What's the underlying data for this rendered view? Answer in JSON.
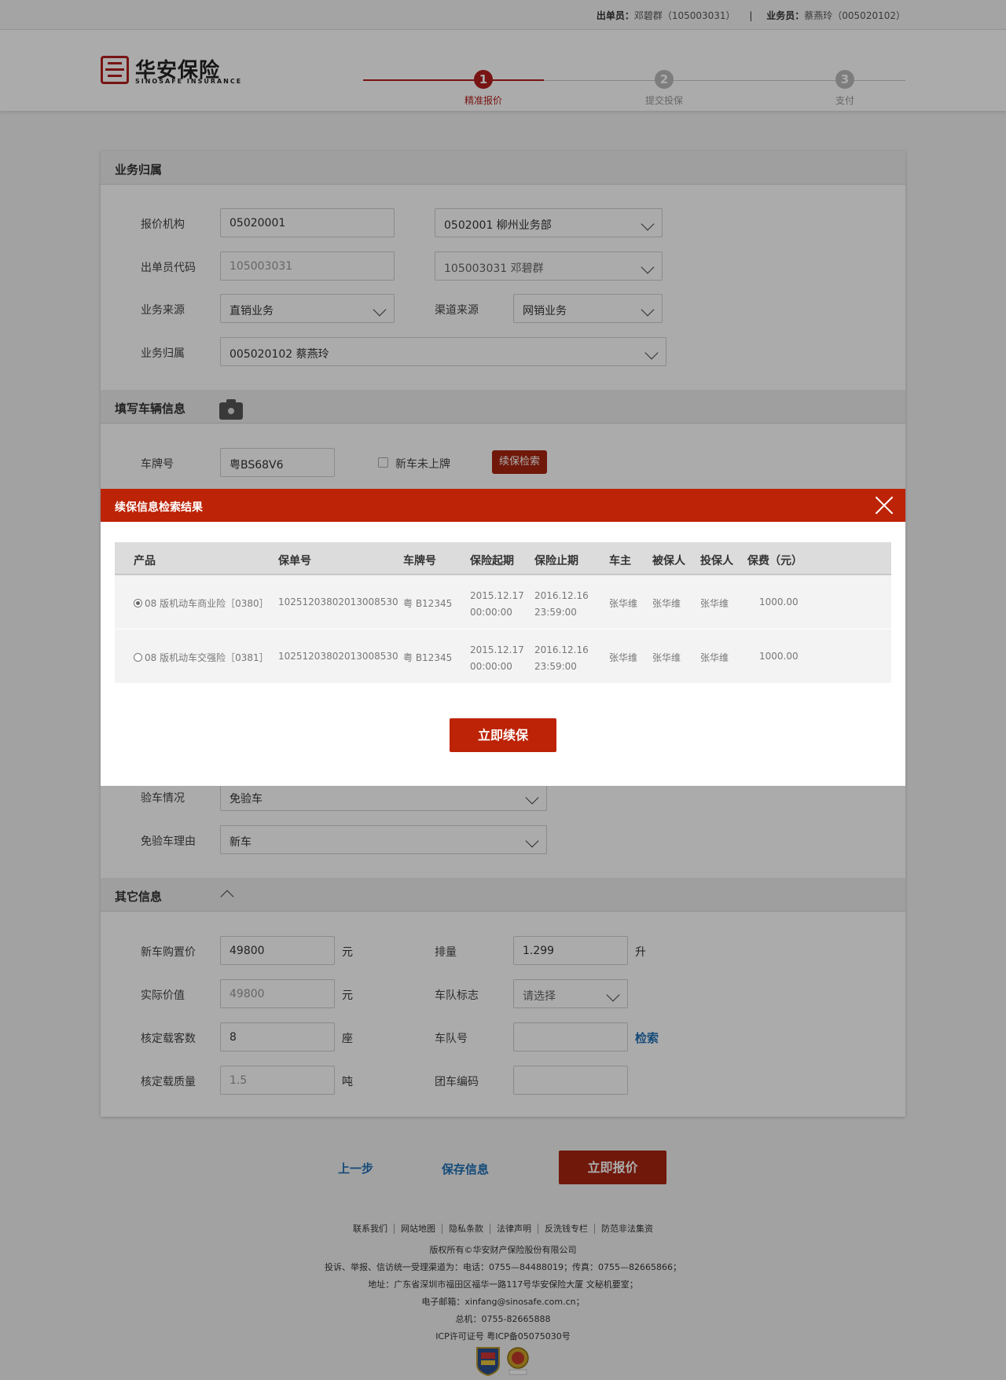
{
  "topbar": {
    "issuer_label": "出单员：",
    "issuer_value": "邓碧群（105003031）",
    "separator": "|",
    "salesman_label": "业务员：",
    "salesman_value": "蔡燕玲（005020102）"
  },
  "logo": {
    "cn": "华安保险",
    "en": "SINOSAFE INSURANCE"
  },
  "steps": [
    {
      "num": "1",
      "label": "精准报价",
      "active": true
    },
    {
      "num": "2",
      "label": "提交投保",
      "active": false
    },
    {
      "num": "3",
      "label": "支付",
      "active": false
    }
  ],
  "colors": {
    "brand_red": "#bd2306",
    "dark_red": "#a8240f",
    "link_blue": "#1f6fb5",
    "inactive_gray": "#bbbbbb"
  },
  "business": {
    "title": "业务归属",
    "quote_org_label": "报价机构",
    "quote_org_code": "05020001",
    "quote_org_name": "0502001 柳州业务部",
    "issuer_code_label": "出单员代码",
    "issuer_code": "105003031",
    "issuer_name": "105003031 邓碧群",
    "source_label": "业务来源",
    "source_value": "直销业务",
    "channel_label": "渠道来源",
    "channel_value": "网销业务",
    "owner_label": "业务归属",
    "owner_value": "005020102 蔡燕玲"
  },
  "vehicle": {
    "title": "填写车辆信息",
    "camera_icon": "camera-icon",
    "plate_label": "车牌号",
    "plate_value": "粤BS68V6",
    "new_car_label": "新车未上牌",
    "search_button": "续保检索",
    "inspection_label": "验车情况",
    "inspection_value": "免验车",
    "exempt_reason_label": "免验车理由",
    "exempt_reason_value": "新车"
  },
  "other": {
    "title": "其它信息",
    "new_price_label": "新车购置价",
    "new_price_value": "49800",
    "new_price_unit": "元",
    "displacement_label": "排量",
    "displacement_value": "1.299",
    "displacement_unit": "升",
    "actual_value_label": "实际价值",
    "actual_value_value": "49800",
    "actual_value_unit": "元",
    "fleet_flag_label": "车队标志",
    "fleet_flag_value": "请选择",
    "seats_label": "核定载客数",
    "seats_value": "8",
    "seats_unit": "座",
    "fleet_no_label": "车队号",
    "fleet_no_value": "",
    "fleet_search": "检索",
    "load_label": "核定载质量",
    "load_value": "1.5",
    "load_unit": "吨",
    "group_code_label": "团车编码",
    "group_code_value": ""
  },
  "actions": {
    "prev": "上一步",
    "save": "保存信息",
    "quote": "立即报价"
  },
  "footer": {
    "links": [
      "联系我们",
      "网站地图",
      "隐私条款",
      "法律声明",
      "反洗钱专栏",
      "防范非法集资"
    ],
    "copyright": "版权所有©华安财产保险股份有限公司",
    "complaint": "投诉、举报、信访统一受理渠道为：电话：0755—84488019；传真：0755—82665866；",
    "address": "地址：广东省深圳市福田区福华一路117号华安保险大厦 文秘机要室；",
    "email": "电子邮箱：xinfang@sinosafe.com.cn；",
    "phone": "总机：0755-82665888",
    "icp": "ICP许可证号 粤ICP备05075030号",
    "badges": [
      "badge-icon",
      "police-badge-icon"
    ]
  },
  "modal": {
    "title": "续保信息检索结果",
    "close_icon": "close-icon",
    "columns": [
      "产品",
      "保单号",
      "车牌号",
      "保险起期",
      "保险止期",
      "车主",
      "被保人",
      "投保人",
      "保费（元）"
    ],
    "rows": [
      {
        "selected": true,
        "product": "08 版机动车商业险［0380］",
        "policy_no": "10251203802013008530",
        "plate": "粤 B12345",
        "start_date": "2015.12.17",
        "start_time": "00:00:00",
        "end_date": "2016.12.16",
        "end_time": "23:59:00",
        "owner": "张华维",
        "insured": "张华维",
        "applicant": "张华维",
        "premium": "1000.00"
      },
      {
        "selected": false,
        "product": "08 版机动车交强险［0381］",
        "policy_no": "10251203802013008530",
        "plate": "粤 B12345",
        "start_date": "2015.12.17",
        "start_time": "00:00:00",
        "end_date": "2016.12.16",
        "end_time": "23:59:00",
        "owner": "张华维",
        "insured": "张华维",
        "applicant": "张华维",
        "premium": "1000.00"
      }
    ],
    "renew_button": "立即续保"
  }
}
